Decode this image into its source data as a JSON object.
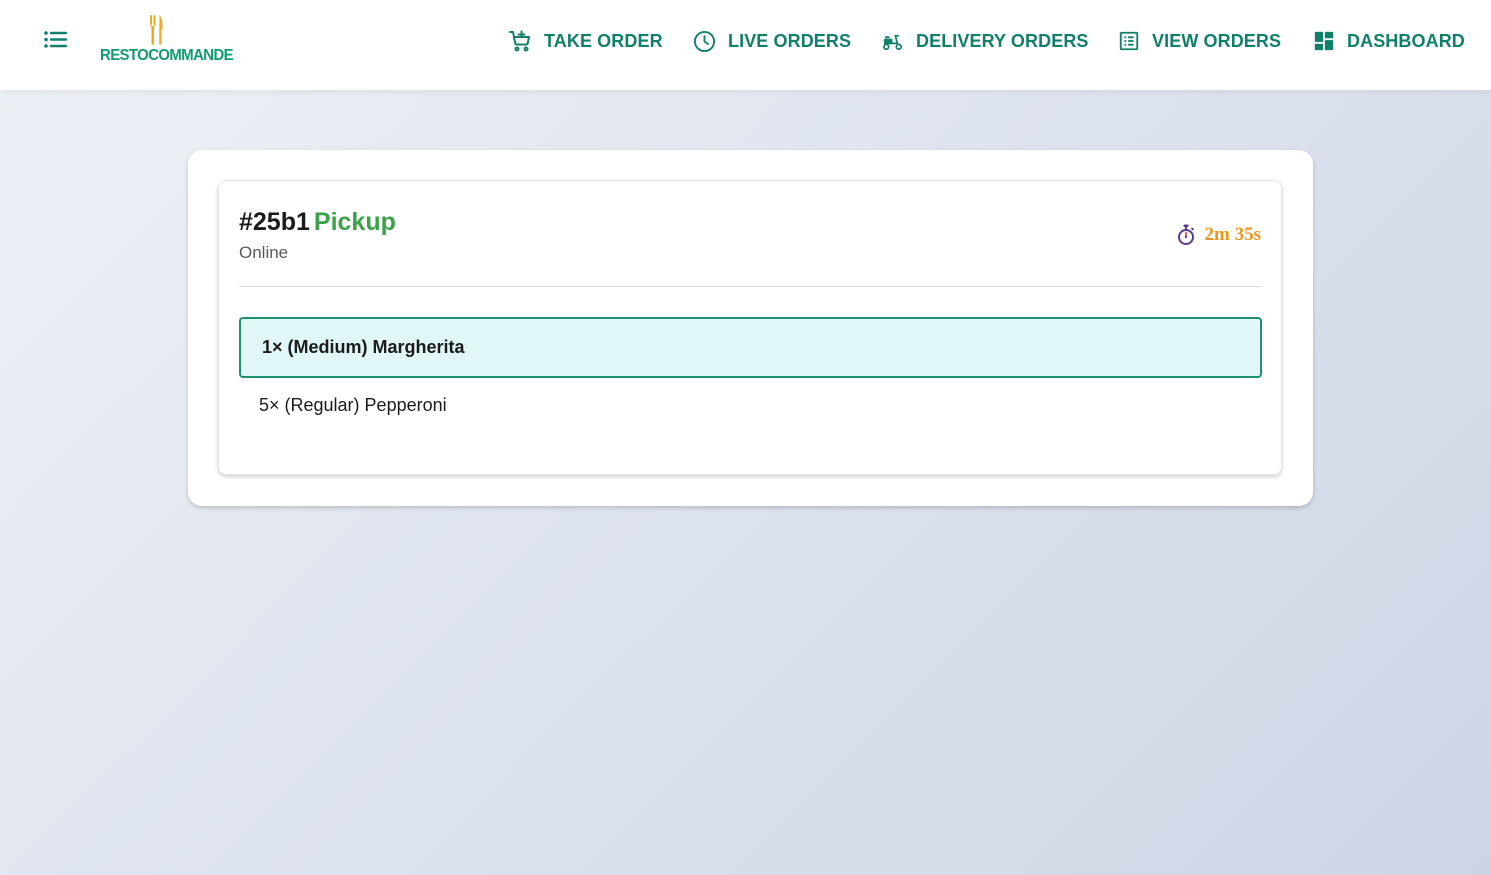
{
  "brand": {
    "name": "RESTOCOMMANDE",
    "colors": {
      "primary": "#0e9a73",
      "nav": "#11806a",
      "accent": "#f0961d",
      "pickup": "#3aa14a",
      "logo_mark": "#f5a623"
    }
  },
  "header": {
    "menu_icon": "menu-list-icon",
    "nav": [
      {
        "label": "TAKE ORDER",
        "icon": "cart-add-icon"
      },
      {
        "label": "LIVE ORDERS",
        "icon": "clock-icon"
      },
      {
        "label": "DELIVERY ORDERS",
        "icon": "scooter-icon"
      },
      {
        "label": "VIEW ORDERS",
        "icon": "list-icon"
      },
      {
        "label": "DASHBOARD",
        "icon": "dashboard-icon"
      }
    ]
  },
  "order": {
    "id": "#25b1",
    "type": "Pickup",
    "source": "Online",
    "timer_icon": "stopwatch-icon",
    "elapsed": "2m 35s",
    "items": [
      {
        "text": "1× (Medium) Margherita",
        "selected": true
      },
      {
        "text": "5× (Regular) Pepperoni",
        "selected": false
      }
    ]
  }
}
